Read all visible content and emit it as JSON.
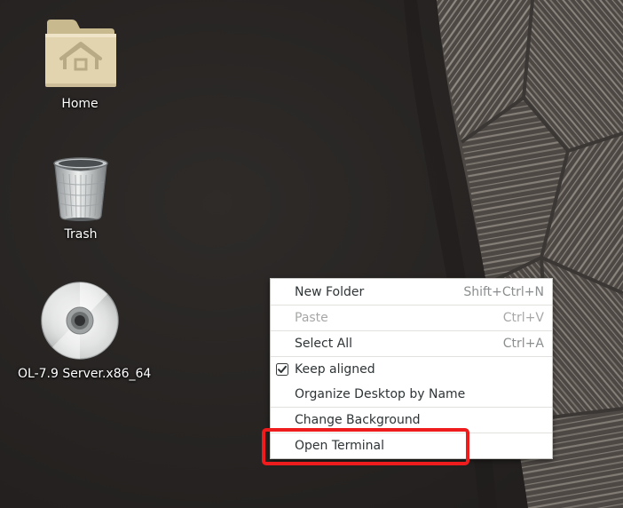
{
  "desktop": {
    "icons": [
      {
        "label": "Home",
        "icon": "home-folder-icon"
      },
      {
        "label": "Trash",
        "icon": "trash-icon"
      },
      {
        "label": "OL-7.9 Server.x86_64",
        "icon": "optical-disc-icon"
      }
    ]
  },
  "context_menu": {
    "items": [
      {
        "label": "New Folder",
        "accel": "Shift+Ctrl+N",
        "enabled": true
      },
      {
        "label": "Paste",
        "accel": "Ctrl+V",
        "enabled": false
      },
      {
        "label": "Select All",
        "accel": "Ctrl+A",
        "enabled": true
      },
      {
        "label": "Keep aligned",
        "accel": "",
        "enabled": true,
        "checked": true
      },
      {
        "label": "Organize Desktop by Name",
        "accel": "",
        "enabled": true
      },
      {
        "label": "Change Background",
        "accel": "",
        "enabled": true
      },
      {
        "label": "Open Terminal",
        "accel": "",
        "enabled": true
      }
    ]
  },
  "annotation": {
    "color": "#ee1c1c",
    "highlighted_item": "Open Terminal"
  }
}
